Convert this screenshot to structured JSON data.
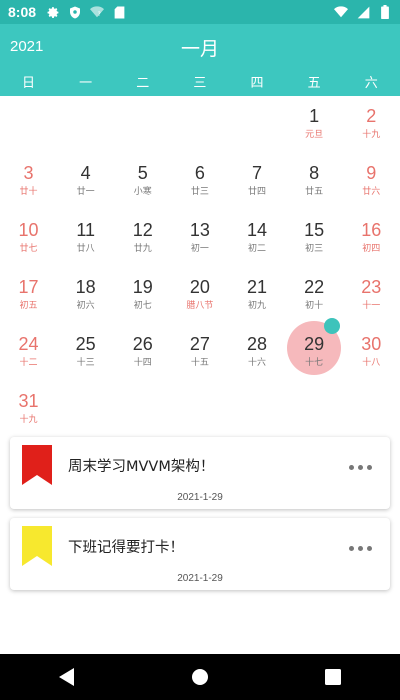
{
  "status_bar": {
    "time": "8:08"
  },
  "calendar": {
    "year": "2021",
    "month": "一月",
    "weekdays": [
      "日",
      "一",
      "二",
      "三",
      "四",
      "五",
      "六"
    ],
    "weeks": [
      [
        null,
        null,
        null,
        null,
        null,
        {
          "day": "1",
          "lunar": "元旦",
          "festival": true
        },
        {
          "day": "2",
          "lunar": "十九"
        }
      ],
      [
        {
          "day": "3",
          "lunar": "廿十"
        },
        {
          "day": "4",
          "lunar": "廿一"
        },
        {
          "day": "5",
          "lunar": "小寒"
        },
        {
          "day": "6",
          "lunar": "廿三"
        },
        {
          "day": "7",
          "lunar": "廿四"
        },
        {
          "day": "8",
          "lunar": "廿五"
        },
        {
          "day": "9",
          "lunar": "廿六"
        }
      ],
      [
        {
          "day": "10",
          "lunar": "廿七"
        },
        {
          "day": "11",
          "lunar": "廿八"
        },
        {
          "day": "12",
          "lunar": "廿九"
        },
        {
          "day": "13",
          "lunar": "初一"
        },
        {
          "day": "14",
          "lunar": "初二"
        },
        {
          "day": "15",
          "lunar": "初三"
        },
        {
          "day": "16",
          "lunar": "初四"
        }
      ],
      [
        {
          "day": "17",
          "lunar": "初五"
        },
        {
          "day": "18",
          "lunar": "初六"
        },
        {
          "day": "19",
          "lunar": "初七"
        },
        {
          "day": "20",
          "lunar": "腊八节",
          "festival": true
        },
        {
          "day": "21",
          "lunar": "初九"
        },
        {
          "day": "22",
          "lunar": "初十"
        },
        {
          "day": "23",
          "lunar": "十一"
        }
      ],
      [
        {
          "day": "24",
          "lunar": "十二"
        },
        {
          "day": "25",
          "lunar": "十三"
        },
        {
          "day": "26",
          "lunar": "十四"
        },
        {
          "day": "27",
          "lunar": "十五"
        },
        {
          "day": "28",
          "lunar": "十六"
        },
        {
          "day": "29",
          "lunar": "十七",
          "selected": true,
          "has_task": true
        },
        {
          "day": "30",
          "lunar": "十八"
        }
      ],
      [
        {
          "day": "31",
          "lunar": "十九"
        },
        null,
        null,
        null,
        null,
        null,
        null
      ]
    ]
  },
  "tasks": [
    {
      "title": "周末学习MVVM架构！",
      "date": "2021-1-29",
      "flag_color": "#e0201a"
    },
    {
      "title": "下班记得要打卡！",
      "date": "2021-1-29",
      "flag_color": "#f7e82e"
    }
  ],
  "colors": {
    "accent": "#3dc7bf",
    "weekend": "#e8736c",
    "selected": "#f6b9bc"
  }
}
